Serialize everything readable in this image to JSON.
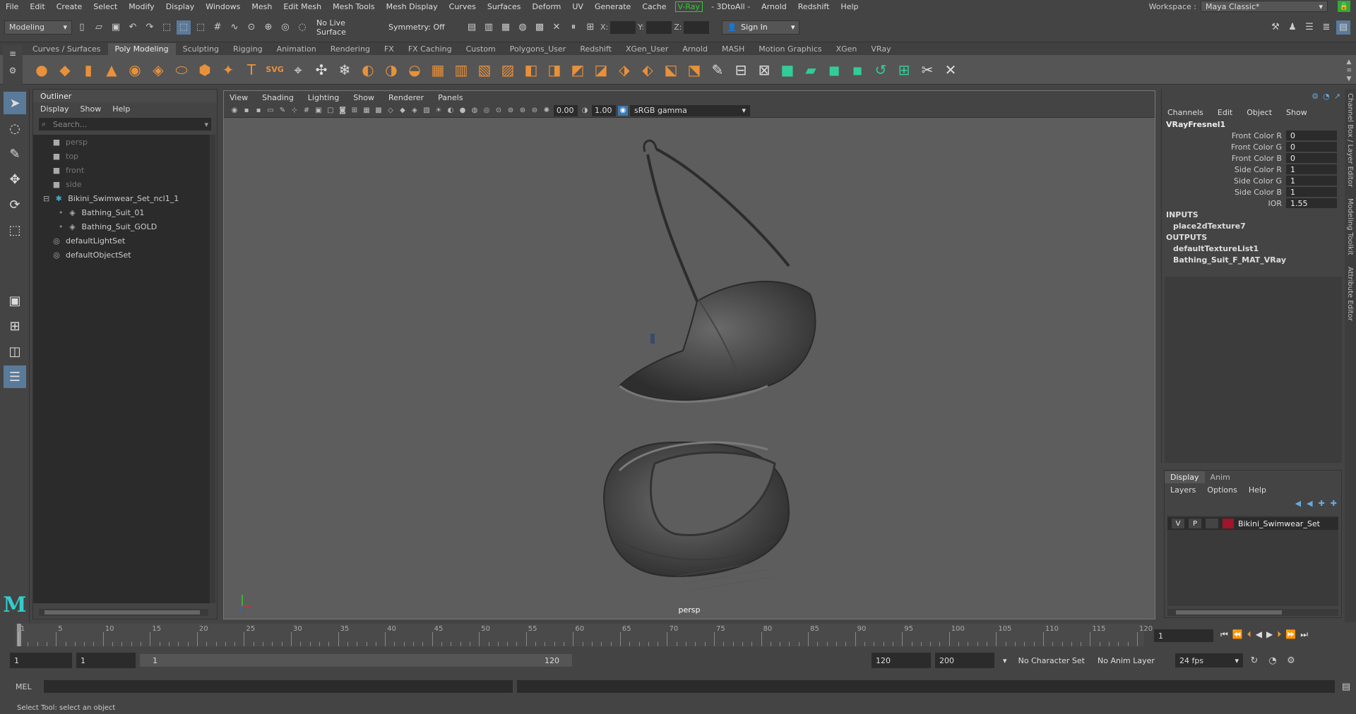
{
  "menubar": {
    "items": [
      "File",
      "Edit",
      "Create",
      "Select",
      "Modify",
      "Display",
      "Windows",
      "Mesh",
      "Edit Mesh",
      "Mesh Tools",
      "Mesh Display",
      "Curves",
      "Surfaces",
      "Deform",
      "UV",
      "Generate",
      "Cache"
    ],
    "vray": "V-Ray",
    "items2": [
      "- 3DtoAll -",
      "Arnold",
      "Redshift",
      "Help"
    ],
    "workspace_label": "Workspace :",
    "workspace_value": "Maya Classic*"
  },
  "statusline": {
    "mode": "Modeling",
    "live_surface": "No Live Surface",
    "symmetry": "Symmetry: Off",
    "x_label": "X:",
    "y_label": "Y:",
    "z_label": "Z:",
    "sign_in": "Sign In"
  },
  "shelf_tabs": [
    "Curves / Surfaces",
    "Poly Modeling",
    "Sculpting",
    "Rigging",
    "Animation",
    "Rendering",
    "FX",
    "FX Caching",
    "Custom",
    "Polygons_User",
    "Redshift",
    "XGen_User",
    "Arnold",
    "MASH",
    "Motion Graphics",
    "XGen",
    "VRay"
  ],
  "shelf_active": "Poly Modeling",
  "outliner": {
    "title": "Outliner",
    "menus": [
      "Display",
      "Show",
      "Help"
    ],
    "search_placeholder": "Search...",
    "items": [
      {
        "label": "persp",
        "dim": true,
        "icon": "camera-icon",
        "indent": 0
      },
      {
        "label": "top",
        "dim": true,
        "icon": "camera-icon",
        "indent": 0
      },
      {
        "label": "front",
        "dim": true,
        "icon": "camera-icon",
        "indent": 0
      },
      {
        "label": "side",
        "dim": true,
        "icon": "camera-icon",
        "indent": 0
      },
      {
        "label": "Bikini_Swimwear_Set_ncl1_1",
        "dim": false,
        "icon": "group-icon",
        "indent": 0
      },
      {
        "label": "Bathing_Suit_01",
        "dim": false,
        "icon": "mesh-icon",
        "indent": 1
      },
      {
        "label": "Bathing_Suit_GOLD",
        "dim": false,
        "icon": "mesh-icon",
        "indent": 1
      },
      {
        "label": "defaultLightSet",
        "dim": false,
        "icon": "set-icon",
        "indent": 0
      },
      {
        "label": "defaultObjectSet",
        "dim": false,
        "icon": "set-icon",
        "indent": 0
      }
    ]
  },
  "viewport": {
    "menus": [
      "View",
      "Shading",
      "Lighting",
      "Show",
      "Renderer",
      "Panels"
    ],
    "exposure": "0.00",
    "gamma": "1.00",
    "color_space": "sRGB gamma",
    "camera": "persp"
  },
  "channel_box": {
    "menus": [
      "Channels",
      "Edit",
      "Object",
      "Show"
    ],
    "node": "VRayFresnel1",
    "attrs": [
      {
        "name": "Front Color R",
        "value": "0"
      },
      {
        "name": "Front Color G",
        "value": "0"
      },
      {
        "name": "Front Color B",
        "value": "0"
      },
      {
        "name": "Side Color R",
        "value": "1"
      },
      {
        "name": "Side Color G",
        "value": "1"
      },
      {
        "name": "Side Color B",
        "value": "1"
      },
      {
        "name": "IOR",
        "value": "1.55"
      }
    ],
    "inputs_label": "INPUTS",
    "inputs": [
      "place2dTexture7"
    ],
    "outputs_label": "OUTPUTS",
    "outputs": [
      "defaultTextureList1",
      "Bathing_Suit_F_MAT_VRay"
    ]
  },
  "side_tabs": [
    "Channel Box / Layer Editor",
    "Modeling Toolkit",
    "Attribute Editor"
  ],
  "layer_editor": {
    "tabs": [
      "Display",
      "Anim"
    ],
    "menus": [
      "Layers",
      "Options",
      "Help"
    ],
    "layer_v": "V",
    "layer_p": "P",
    "layer_name": "Bikini_Swimwear_Set",
    "layer_color": "#a0152a"
  },
  "timeline": {
    "ticks": [
      "1",
      "5",
      "10",
      "15",
      "20",
      "25",
      "30",
      "35",
      "40",
      "45",
      "50",
      "55",
      "60",
      "65",
      "70",
      "75",
      "80",
      "85",
      "90",
      "95",
      "100",
      "105",
      "110",
      "115",
      "120"
    ],
    "current_frame": "1"
  },
  "range": {
    "start": "1",
    "playback_start": "1",
    "range_start": "1",
    "range_end": "120",
    "playback_end": "120",
    "end": "200",
    "char_set": "No Character Set",
    "anim_layer": "No Anim Layer",
    "fps": "24 fps"
  },
  "cmdline": {
    "lang": "MEL"
  },
  "helpline": {
    "text": "Select Tool: select an object"
  }
}
